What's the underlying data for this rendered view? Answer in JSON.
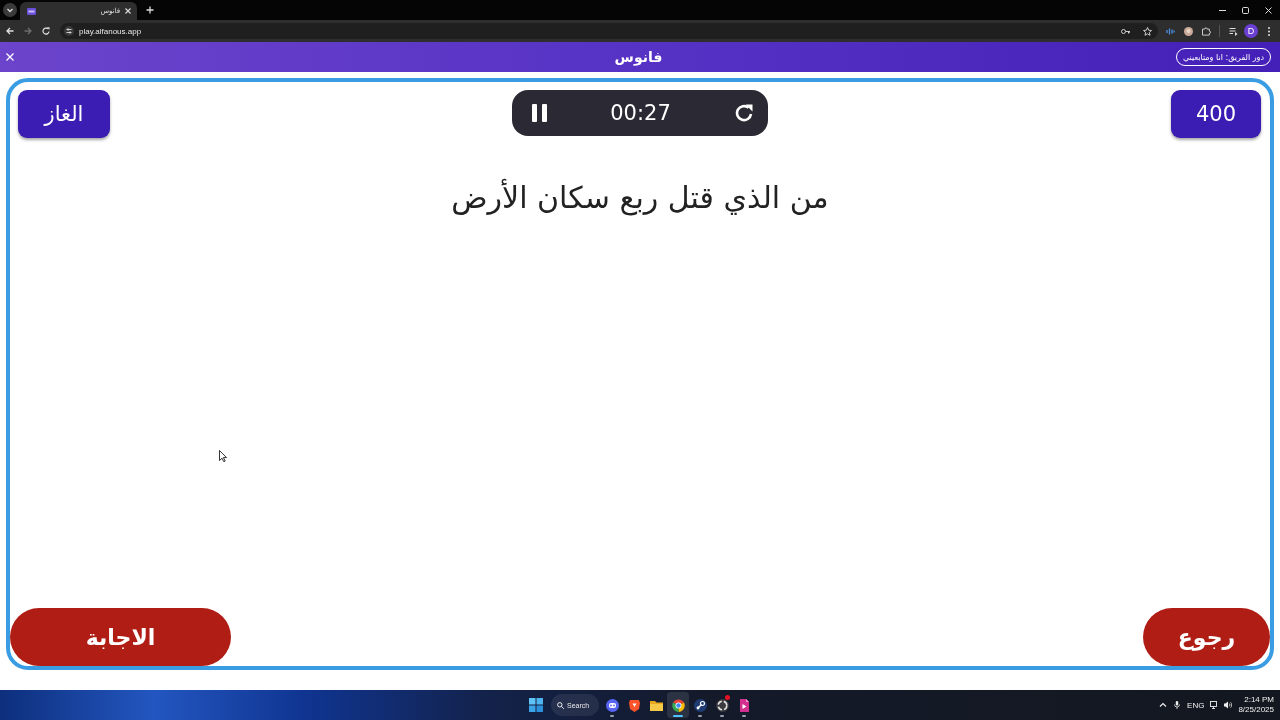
{
  "browser": {
    "tab": {
      "title": "فانوس"
    },
    "nav": {
      "back_disabled": false,
      "forward_disabled": true
    },
    "address": "play.alfanous.app",
    "profile_initial": "D"
  },
  "header": {
    "logo": "فانوس",
    "team_button": "دور الفريق: انا ومتابعيني"
  },
  "game": {
    "category": "الغاز",
    "timer": {
      "time": "00:27",
      "running": true
    },
    "points": "400",
    "question": "من الذي قتل ربع سكان الأرض",
    "answer_button": "الاجابة",
    "back_button": "رجوع"
  },
  "taskbar": {
    "search": "Search",
    "apps": [
      {
        "kind": "discord",
        "open": true,
        "active": false,
        "badge": false
      },
      {
        "kind": "brave",
        "open": false,
        "active": false,
        "badge": false
      },
      {
        "kind": "files",
        "open": false,
        "active": false,
        "badge": false
      },
      {
        "kind": "chrome",
        "open": true,
        "active": true,
        "badge": false
      },
      {
        "kind": "steam",
        "open": true,
        "active": false,
        "badge": false
      },
      {
        "kind": "obs",
        "open": true,
        "active": false,
        "badge": true
      },
      {
        "kind": "page",
        "open": true,
        "active": false,
        "badge": false
      }
    ],
    "language": "ENG",
    "time": "2:14 PM",
    "date": "8/25/2025"
  }
}
